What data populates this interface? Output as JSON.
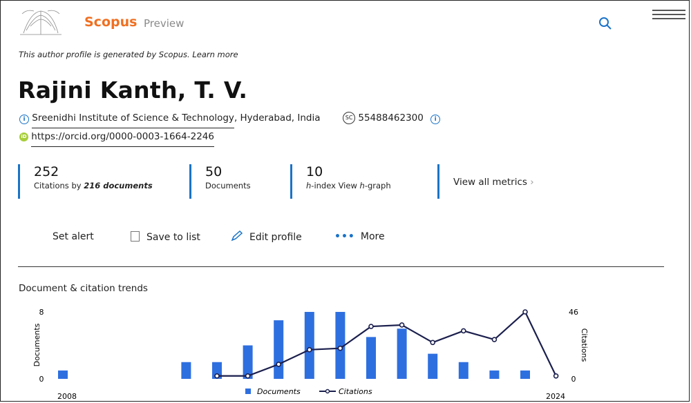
{
  "header": {
    "brand": "Scopus",
    "brand_sub": "Preview"
  },
  "notice": "This author profile is generated by Scopus. Learn more",
  "author": {
    "name": "Rajini Kanth, T. V.",
    "affiliation_link": "Sreenidhi Institute of Science & Technology",
    "affiliation_rest": ", Hyderabad, India",
    "scopus_id": "55488462300",
    "orcid": "https://orcid.org/0000-0003-1664-2246"
  },
  "metrics": [
    {
      "value": "252",
      "label_pre": "Citations by ",
      "label_bold": "216 documents"
    },
    {
      "value": "50",
      "label": "Documents"
    },
    {
      "value": "10",
      "label_pre": "h",
      "label_mid": "-index View ",
      "label_em2": "h",
      "label_post": "-graph"
    }
  ],
  "view_all": "View all metrics",
  "actions": {
    "set_alert": "Set alert",
    "save": "Save to list",
    "edit": "Edit profile",
    "more": "More"
  },
  "chart_title": "Document & citation trends",
  "chart_data": {
    "type": "bar+line",
    "x_start_label": "2008",
    "x_end_label": "2024",
    "y_left_label": "Documents",
    "y_right_label": "Citations",
    "y_left_ticks": [
      "8",
      "0"
    ],
    "y_right_ticks": [
      "46",
      "0"
    ],
    "y_left_max": 8,
    "y_right_max": 46,
    "years": [
      2008,
      2009,
      2010,
      2011,
      2012,
      2013,
      2014,
      2015,
      2016,
      2017,
      2018,
      2019,
      2020,
      2021,
      2022,
      2023,
      2024
    ],
    "documents": [
      1,
      0,
      0,
      0,
      2,
      2,
      4,
      7,
      8,
      8,
      5,
      6,
      3,
      2,
      1,
      1,
      0
    ],
    "citations": [
      null,
      null,
      null,
      null,
      null,
      2,
      2,
      10,
      20,
      21,
      36,
      37,
      25,
      33,
      27,
      46,
      2
    ],
    "legend": [
      "Documents",
      "Citations"
    ],
    "colors": {
      "bar": "#2e6fe0",
      "line": "#1b1f4d"
    }
  }
}
